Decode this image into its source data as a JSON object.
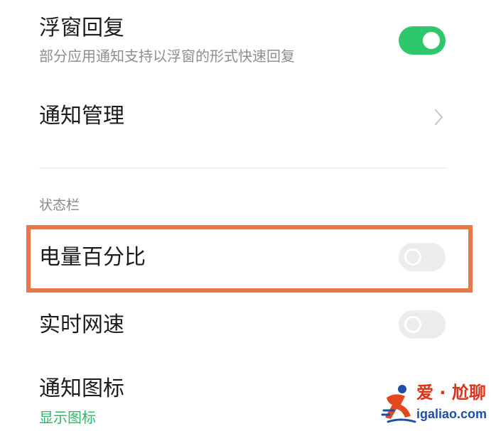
{
  "settings": {
    "float_reply": {
      "title": "浮窗回复",
      "subtitle": "部分应用通知支持以浮窗的形式快速回复",
      "enabled": true
    },
    "notification_manage": {
      "title": "通知管理"
    },
    "status_bar_section": {
      "label": "状态栏"
    },
    "battery_percentage": {
      "title": "电量百分比",
      "enabled": false
    },
    "realtime_speed": {
      "title": "实时网速",
      "enabled": false
    },
    "notification_icon": {
      "title": "通知图标",
      "value": "显示图标"
    }
  },
  "colors": {
    "toggle_on": "#2ec76b",
    "toggle_off": "#ececec",
    "highlight": "#e8784a",
    "link_green": "#2fb866"
  },
  "watermark": {
    "name_cn": "爱 · 尬聊",
    "domain": "igaliao.com"
  }
}
